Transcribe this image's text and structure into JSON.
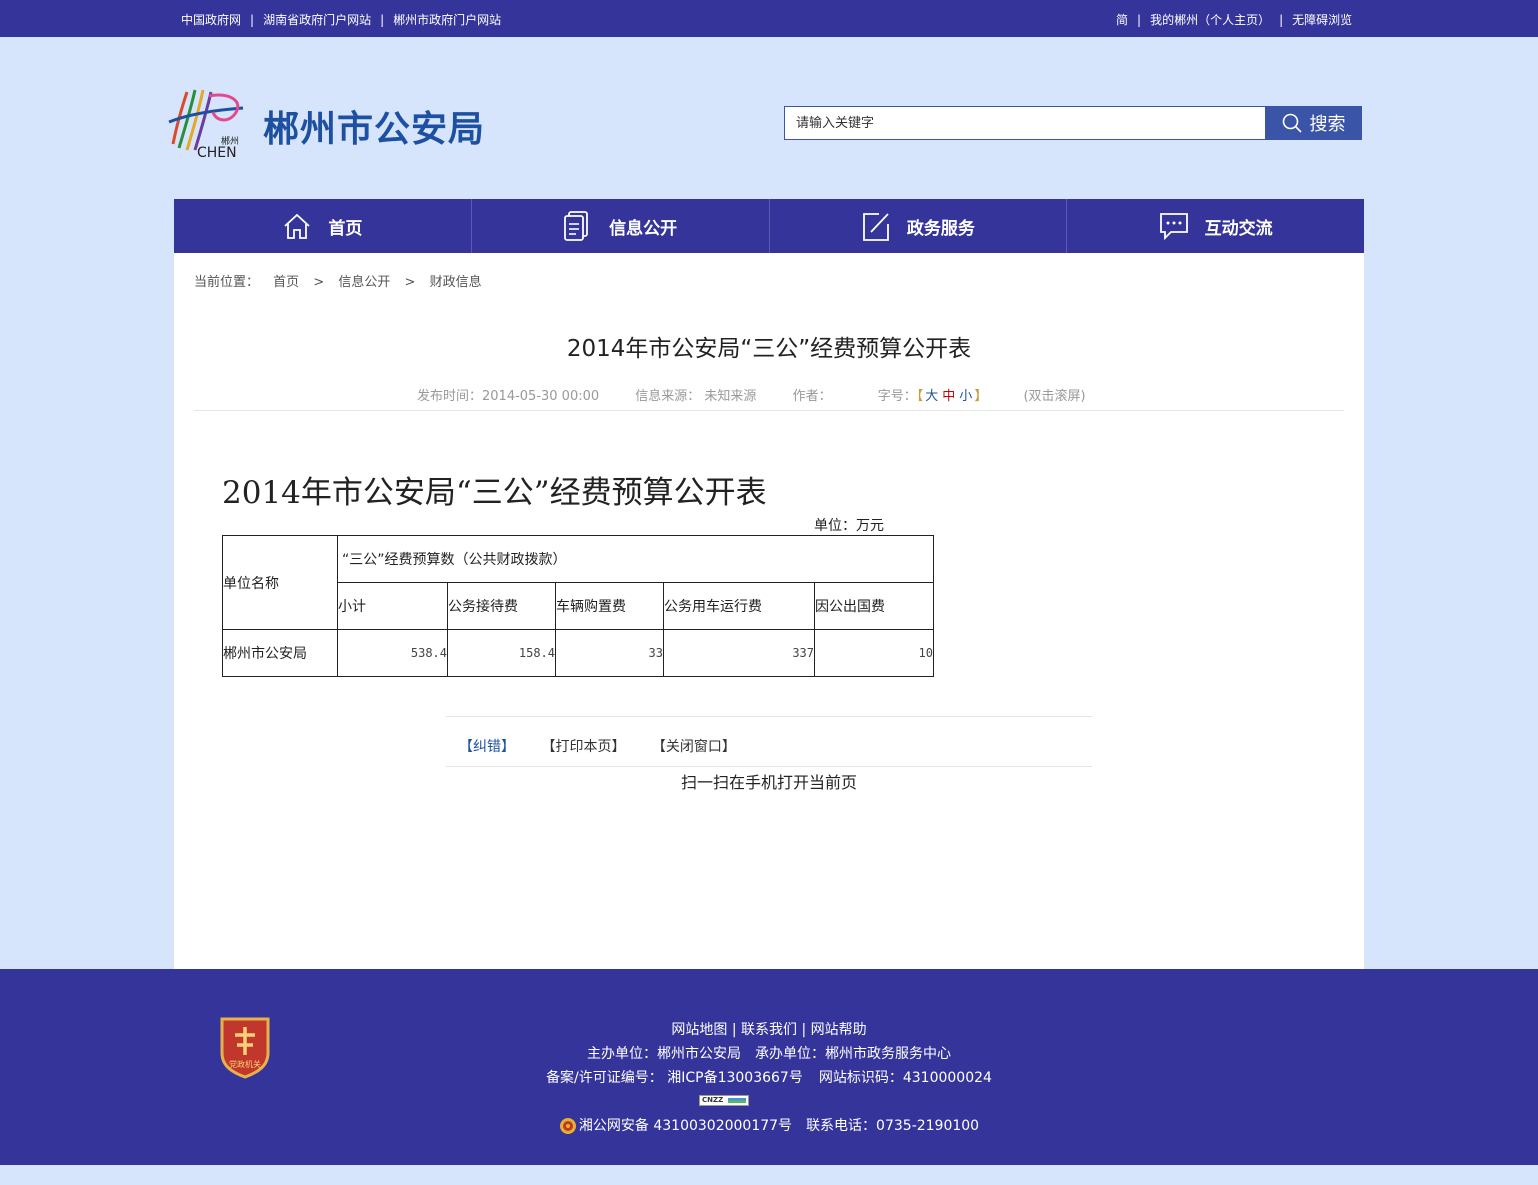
{
  "topbar": {
    "left_links": [
      "中国政府网",
      "湖南省政府门户网站",
      "郴州市政府门户网站"
    ],
    "right_links": [
      "简",
      "我的郴州（个人主页）",
      "无障碍浏览"
    ]
  },
  "header": {
    "logo_text": "郴州",
    "logo_sub": "CHEN",
    "site_name": "郴州市公安局",
    "search_placeholder": "请输入关键字",
    "search_label": "搜索"
  },
  "nav": [
    {
      "label": "首页",
      "icon": "home-icon"
    },
    {
      "label": "信息公开",
      "icon": "document-icon"
    },
    {
      "label": "政务服务",
      "icon": "edit-icon"
    },
    {
      "label": "互动交流",
      "icon": "chat-icon"
    }
  ],
  "breadcrumb": {
    "prefix": "当前位置：",
    "items": [
      "首页",
      "信息公开",
      "财政信息"
    ],
    "sep": ">"
  },
  "article": {
    "title": "2014年市公安局“三公”经费预算公开表",
    "publish_time": "发布时间：2014-05-30 00:00",
    "source": "信息来源： 未知来源",
    "author": "作者：",
    "font_size_label": "字号：",
    "font_large": "大",
    "font_mid": "中",
    "font_small": "小",
    "bracket_open": "【",
    "bracket_close": "】",
    "dblclick": "(双击滚屏)",
    "content_title": "2014年市公安局“三公”经费预算公开表",
    "unit": "单位：万元"
  },
  "table": {
    "unit_name_header": "单位名称",
    "group_header": "“三公”经费预算数（公共财政拨款）",
    "columns": [
      "小计",
      "公务接待费",
      "车辆购置费",
      "公务用车运行费",
      "因公出国费"
    ],
    "row": {
      "name": "郴州市公安局",
      "values": [
        "538.4",
        "158.4",
        "33",
        "337",
        "10"
      ]
    }
  },
  "actions": {
    "correct": "【纠错】",
    "print": "【打印本页】",
    "close": "【关闭窗口】",
    "scan": "扫一扫在手机打开当前页"
  },
  "footer": {
    "links": [
      "网站地图",
      "联系我们",
      "网站帮助"
    ],
    "sponsor": "主办单位：郴州市公安局",
    "organizer": "承办单位：郴州市政务服务中心",
    "icp": "备案/许可证编号： 湘ICP备13003667号",
    "site_id": "网站标识码：4310000024",
    "cnzz": "CNZZ",
    "police_record": "湘公网安备 43100302000177号",
    "phone": "联系电话：0735-2190100",
    "badge_text": "党政机关"
  },
  "colors": {
    "primary": "#35349a",
    "background": "#d6e4fc",
    "site_name": "#1e50a2",
    "search_button": "#3a55a8"
  }
}
